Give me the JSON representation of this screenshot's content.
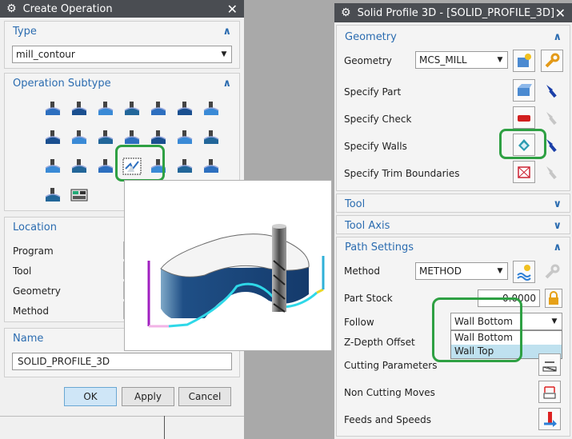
{
  "create_operation": {
    "title": "Create Operation",
    "type": {
      "label": "Type",
      "value": "mill_contour"
    },
    "subtype": {
      "label": "Operation Subtype"
    },
    "location": {
      "label": "Location",
      "fields": [
        "Program",
        "Tool",
        "Geometry",
        "Method"
      ]
    },
    "name": {
      "label": "Name",
      "value": "SOLID_PROFILE_3D"
    },
    "buttons": {
      "ok": "OK",
      "apply": "Apply",
      "cancel": "Cancel"
    }
  },
  "solid_profile": {
    "title": "Solid Profile 3D - [SOLID_PROFILE_3D]",
    "geometry": {
      "label": "Geometry",
      "geometry_field": {
        "label": "Geometry",
        "value": "MCS_MILL"
      },
      "rows": [
        "Specify Part",
        "Specify Check",
        "Specify Walls",
        "Specify Trim Boundaries"
      ]
    },
    "tool": {
      "label": "Tool"
    },
    "tool_axis": {
      "label": "Tool Axis"
    },
    "path_settings": {
      "label": "Path Settings",
      "method": {
        "label": "Method",
        "value": "METHOD"
      },
      "part_stock": {
        "label": "Part Stock",
        "value": "0.0000"
      },
      "follow": {
        "label": "Follow",
        "value": "Wall Bottom",
        "options": [
          "Wall Bottom",
          "Wall Top"
        ]
      },
      "z_depth": {
        "label": "Z-Depth Offset"
      },
      "cutting": {
        "label": "Cutting Parameters"
      },
      "non_cutting": {
        "label": "Non Cutting Moves"
      },
      "feeds": {
        "label": "Feeds and Speeds"
      }
    }
  },
  "colors": {
    "accent": "#2b6cb0",
    "highlight": "#2ea043",
    "selected": "#bfe1ef",
    "titlebar": "#4a4d52"
  }
}
